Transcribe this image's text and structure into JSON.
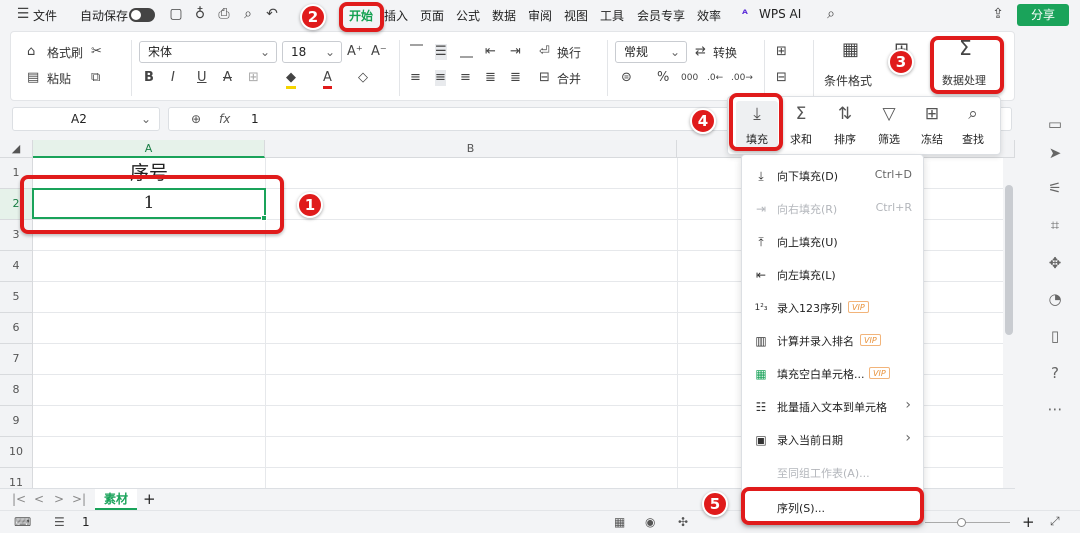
{
  "menubar": {
    "file_label": "文件",
    "autosave_label": "自动保存",
    "tabs": [
      "开始",
      "插入",
      "页面",
      "公式",
      "数据",
      "审阅",
      "视图",
      "工具",
      "会员专享",
      "效率"
    ],
    "active_tab": "开始",
    "wps_ai_label": "WPS AI",
    "share_label": "分享"
  },
  "ribbon": {
    "format_painter": "格式刷",
    "paste": "粘贴",
    "font_name": "宋体",
    "font_size": "18",
    "wrap_label": "换行",
    "merge_label": "合并",
    "number_format": "常规",
    "convert_label": "转换",
    "cond_format_label": "条件格式",
    "data_processing_label": "数据处理"
  },
  "formula_bar": {
    "name_box": "A2",
    "fx_label": "fx",
    "value": "1"
  },
  "grid": {
    "columns": [
      "A",
      "B"
    ],
    "rows": [
      "1",
      "2",
      "3",
      "4",
      "5",
      "6",
      "7",
      "8",
      "9",
      "10",
      "11"
    ],
    "cells": {
      "A1": "序号",
      "A2": "1"
    }
  },
  "data_panel": {
    "buttons": [
      "填充",
      "求和",
      "排序",
      "筛选",
      "冻结",
      "查找"
    ]
  },
  "fill_menu": {
    "items": [
      {
        "label": "向下填充(D)",
        "shortcut": "Ctrl+D"
      },
      {
        "label": "向右填充(R)",
        "shortcut": "Ctrl+R",
        "disabled": true
      },
      {
        "label": "向上填充(U)"
      },
      {
        "label": "向左填充(L)"
      },
      {
        "label": "录入123序列",
        "vip": "VIP"
      },
      {
        "label": "计算并录入排名",
        "vip": "VIP"
      },
      {
        "label": "填充空白单元格...",
        "vip": "VIP"
      },
      {
        "label": "批量插入文本到单元格",
        "submenu": true
      },
      {
        "label": "录入当前日期",
        "submenu": true
      },
      {
        "label": "至同组工作表(A)...",
        "disabled": true
      },
      {
        "label": "序列(S)..."
      }
    ]
  },
  "sheet_tabs": {
    "active": "素材"
  },
  "status": {
    "value": "1"
  },
  "annotations": [
    "1",
    "2",
    "3",
    "4",
    "5"
  ],
  "colors": {
    "accent": "#12a150",
    "annotation": "#e01b1b",
    "share": "#1aa35a"
  }
}
